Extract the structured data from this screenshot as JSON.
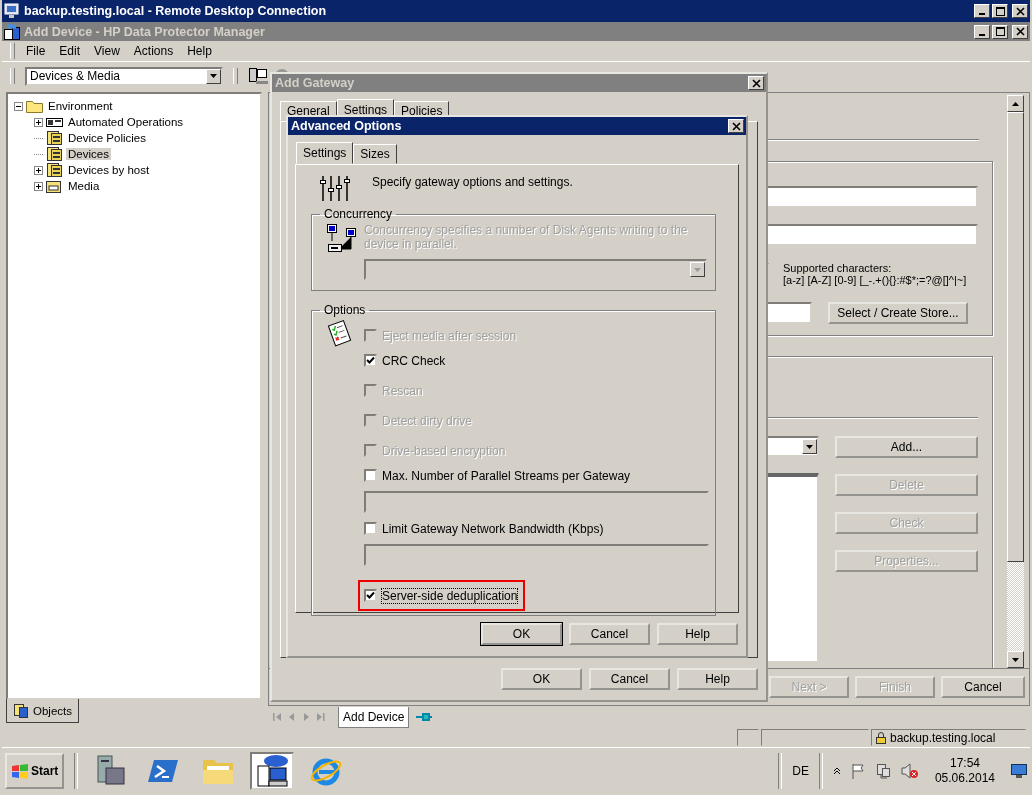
{
  "rdp_window": {
    "title": "backup.testing.local - Remote Desktop Connection"
  },
  "app_window": {
    "title": "Add Device - HP Data Protector Manager"
  },
  "menu": [
    "File",
    "Edit",
    "View",
    "Actions",
    "Help"
  ],
  "toolbar": {
    "context": "Devices & Media"
  },
  "tree": [
    {
      "label": "Environment",
      "kind": "folder",
      "has_children": true,
      "expanded": true,
      "selected": false,
      "children": [
        {
          "label": "Automated Operations",
          "kind": "operations",
          "has_children": true,
          "expanded": false,
          "selected": false
        },
        {
          "label": "Device Policies",
          "kind": "device",
          "has_children": false,
          "expanded": false,
          "selected": false
        },
        {
          "label": "Devices",
          "kind": "device",
          "has_children": false,
          "expanded": false,
          "selected": true
        },
        {
          "label": "Devices by host",
          "kind": "device",
          "has_children": true,
          "expanded": false,
          "selected": false
        },
        {
          "label": "Media",
          "kind": "media",
          "has_children": true,
          "expanded": false,
          "selected": false
        }
      ]
    }
  ],
  "left_tabs": [
    {
      "label": "Objects",
      "selected": true
    }
  ],
  "wizard": {
    "supported_label": "Supported characters:",
    "supported_chars": "[a-z] [A-Z] [0-9] [_-.+(){}:#$*;=?@[]^|~]",
    "store_button": {
      "label": "Select / Create Store...",
      "disabled": false
    },
    "side_buttons": [
      {
        "label": "Add...",
        "disabled": false
      },
      {
        "label": "Delete",
        "disabled": true
      },
      {
        "label": "Check",
        "disabled": true
      },
      {
        "label": "Properties...",
        "disabled": true
      }
    ],
    "nav_buttons": [
      {
        "label": "Next >",
        "disabled": true
      },
      {
        "label": "Finish",
        "disabled": true
      },
      {
        "label": "Cancel",
        "disabled": false
      }
    ]
  },
  "add_gateway": {
    "title": "Add Gateway",
    "tabs": [
      {
        "label": "General",
        "selected": false
      },
      {
        "label": "Settings",
        "selected": true
      },
      {
        "label": "Policies",
        "selected": false
      }
    ],
    "buttons": [
      "OK",
      "Cancel",
      "Help"
    ]
  },
  "advanced_options": {
    "title": "Advanced Options",
    "tabs": [
      {
        "label": "Settings",
        "selected": true
      },
      {
        "label": "Sizes",
        "selected": false
      }
    ],
    "intro": "Specify gateway options and settings.",
    "concurrency": {
      "legend": "Concurrency",
      "description": "Concurrency specifies a number of Disk Agents writing to the device in parallel.",
      "disabled": true
    },
    "options": {
      "legend": "Options",
      "items": [
        {
          "kind": "checkbox",
          "label": "Eject media after session",
          "checked": false,
          "disabled": true,
          "highlighted": false
        },
        {
          "kind": "checkbox",
          "label": "CRC Check",
          "checked": true,
          "disabled": false,
          "highlighted": false
        },
        {
          "kind": "checkbox",
          "label": "Rescan",
          "checked": false,
          "disabled": true,
          "highlighted": false
        },
        {
          "kind": "checkbox",
          "label": "Detect dirty drive",
          "checked": false,
          "disabled": true,
          "highlighted": false
        },
        {
          "kind": "checkbox",
          "label": "Drive-based encryption",
          "checked": false,
          "disabled": true,
          "highlighted": false
        },
        {
          "kind": "checkbox",
          "label": "Max. Number of Parallel Streams per Gateway",
          "checked": false,
          "disabled": false,
          "highlighted": false
        },
        {
          "kind": "field",
          "disabled": true
        },
        {
          "kind": "checkbox",
          "label": "Limit Gateway Network Bandwidth (Kbps)",
          "checked": false,
          "disabled": false,
          "highlighted": false
        },
        {
          "kind": "field",
          "disabled": true
        },
        {
          "kind": "checkbox",
          "label": "Server-side deduplication",
          "checked": true,
          "disabled": false,
          "highlighted": true
        }
      ]
    },
    "buttons": [
      "OK",
      "Cancel",
      "Help"
    ]
  },
  "workspace_tabs": [
    {
      "label": "Add Device",
      "selected": true
    }
  ],
  "status_bar": {
    "host": "backup.testing.local"
  },
  "taskbar": {
    "start": "Start",
    "apps": [
      {
        "kind": "server",
        "selected": false
      },
      {
        "kind": "shell",
        "selected": false
      },
      {
        "kind": "folder",
        "selected": false
      },
      {
        "kind": "protector",
        "selected": true
      },
      {
        "kind": "browser",
        "selected": false
      }
    ],
    "language": "DE",
    "time": "17:54",
    "date": "05.06.2014"
  }
}
